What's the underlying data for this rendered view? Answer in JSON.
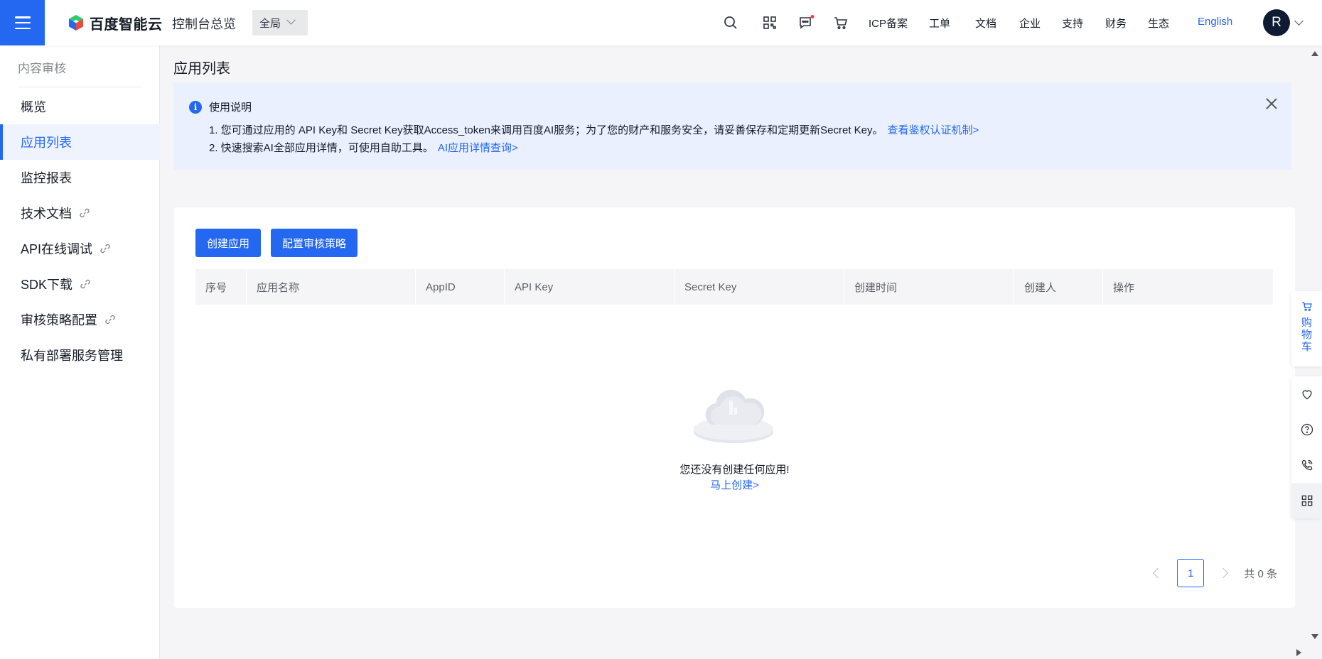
{
  "header": {
    "menu_icon": "hamburger-icon",
    "logo_text": "百度智能云",
    "console_label": "控制台总览",
    "region_value": "全局",
    "icons": [
      "search-icon",
      "qrcode-icon",
      "message-icon",
      "cart-icon"
    ],
    "nav": [
      "ICP备案",
      "工单",
      "文档",
      "企业",
      "支持",
      "财务",
      "生态"
    ],
    "language_label": "English",
    "avatar_initial": "R"
  },
  "sidebar": {
    "title": "内容审核",
    "items": [
      {
        "label": "概览",
        "link": false
      },
      {
        "label": "应用列表",
        "link": false,
        "active": true
      },
      {
        "label": "监控报表",
        "link": false
      },
      {
        "label": "技术文档",
        "link": true
      },
      {
        "label": "API在线调试",
        "link": true
      },
      {
        "label": "SDK下载",
        "link": true
      },
      {
        "label": "审核策略配置",
        "link": true
      },
      {
        "label": "私有部署服务管理",
        "link": false
      }
    ]
  },
  "main": {
    "title": "应用列表",
    "notice": {
      "title": "使用说明",
      "line1": "1. 您可通过应用的 API Key和 Secret Key获取Access_token来调用百度AI服务；为了您的财产和服务安全，请妥善保存和定期更新Secret Key。",
      "line1_link": "查看鉴权认证机制>",
      "line2": "2. 快速搜索AI全部应用详情，可使用自助工具。",
      "line2_link": "AI应用详情查询>"
    },
    "buttons": {
      "create": "创建应用",
      "policy": "配置审核策略"
    },
    "table_headers": [
      "序号",
      "应用名称",
      "AppID",
      "API Key",
      "Secret Key",
      "创建时间",
      "创建人",
      "操作"
    ],
    "empty_text": "您还没有创建任何应用!",
    "empty_link": "马上创建>",
    "pagination": {
      "current_page": "1",
      "total": "共 0 条"
    }
  },
  "float_bar": {
    "cart_label": [
      "购",
      "物",
      "车"
    ],
    "tools": [
      "heart-icon",
      "help-icon",
      "phone-icon",
      "apps-icon"
    ]
  },
  "colors": {
    "accent": "#2468f2",
    "notice_bg": "#eaf0fd",
    "avatar_bg": "#0f1b33"
  }
}
